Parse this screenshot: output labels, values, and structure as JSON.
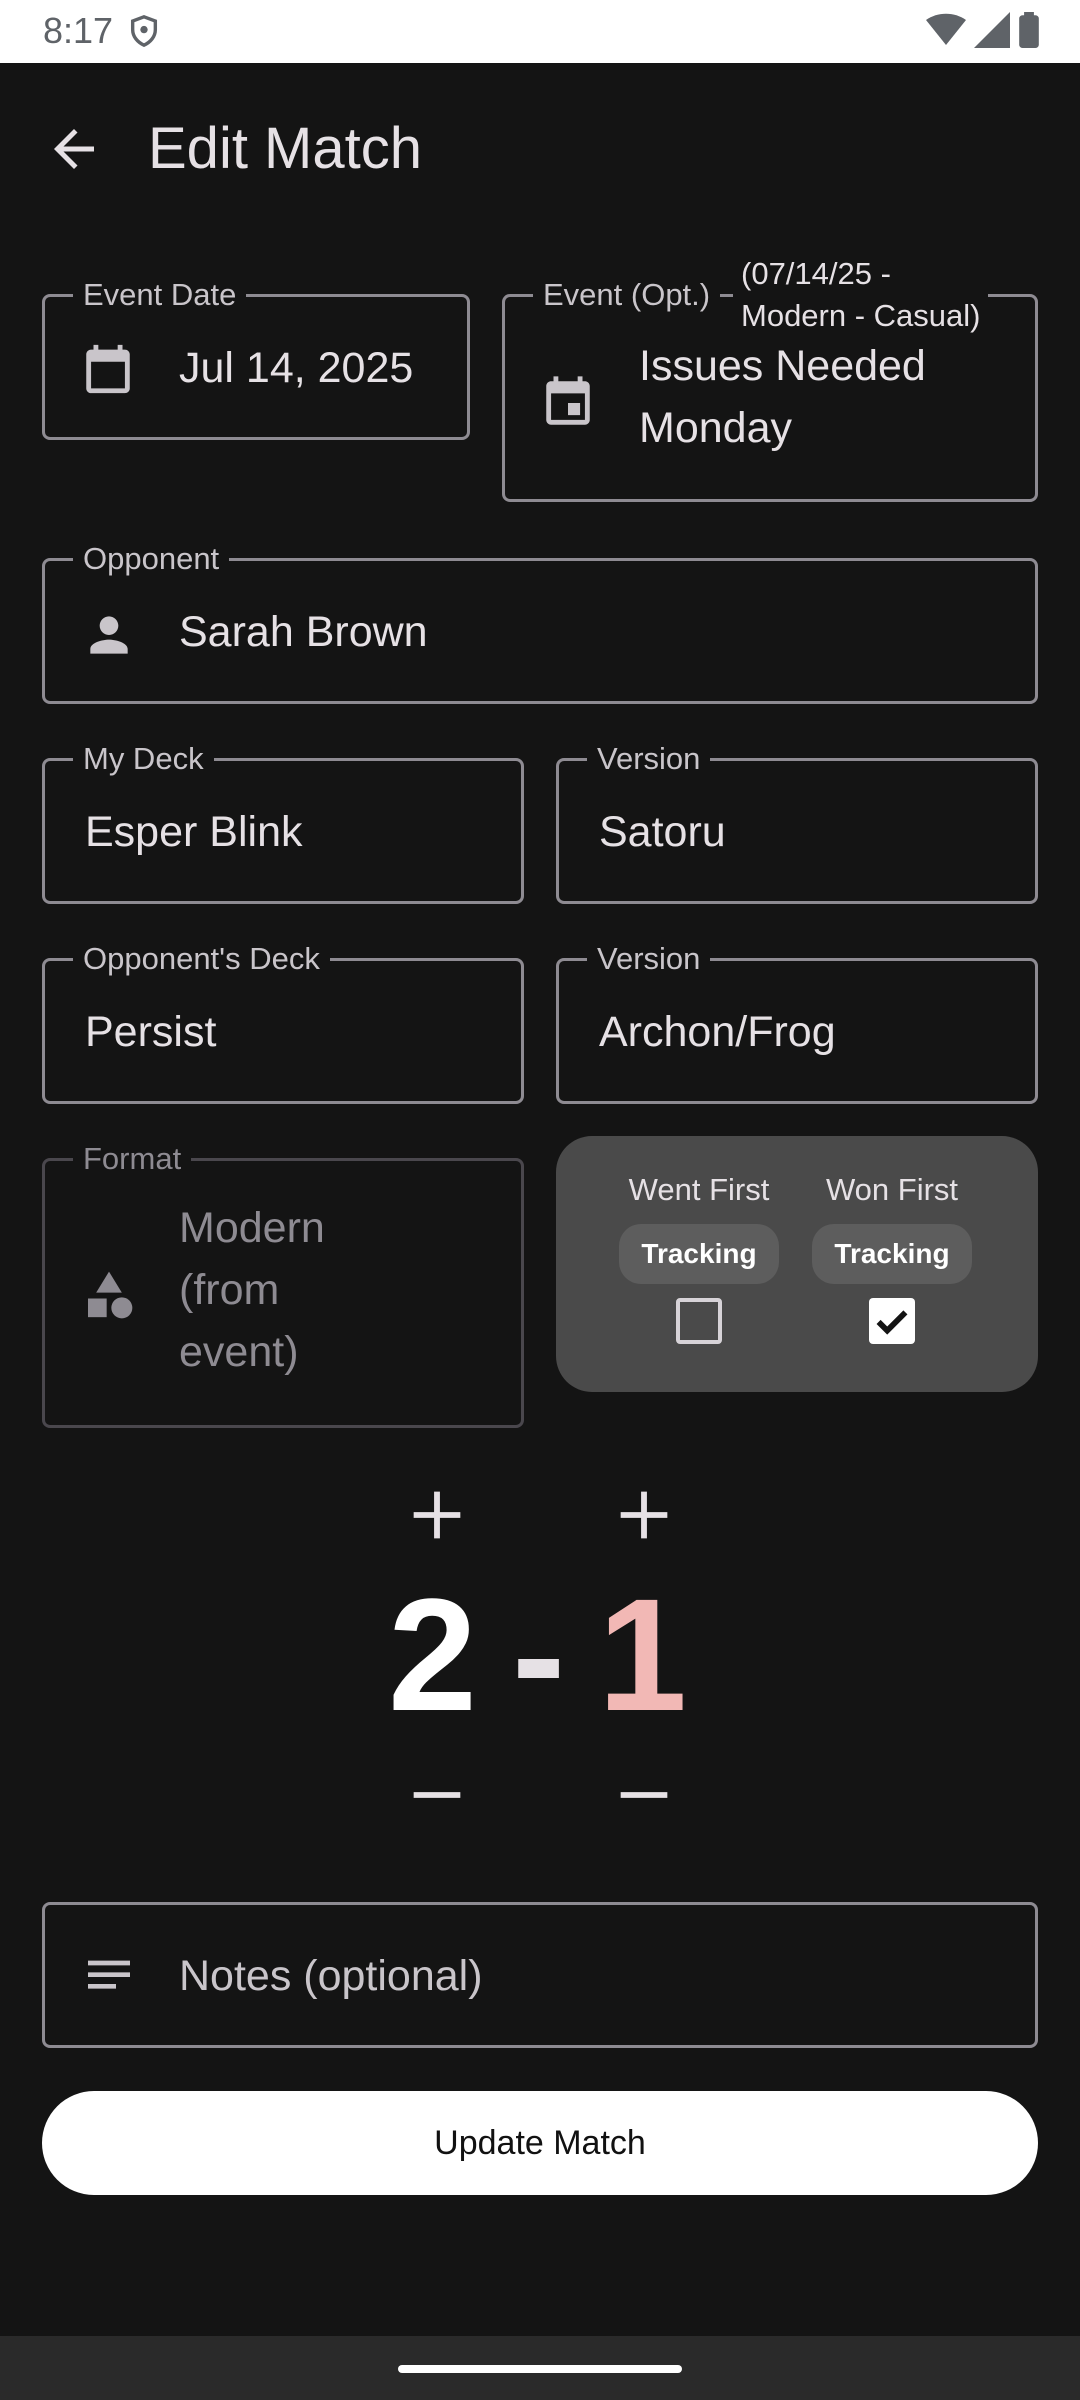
{
  "status_bar": {
    "time": "8:17"
  },
  "header": {
    "title": "Edit Match"
  },
  "form": {
    "event_date": {
      "label": "Event Date",
      "value": "Jul 14, 2025"
    },
    "event": {
      "label": "Event (Opt.)",
      "sublabel_line1": "(07/14/25 -",
      "sublabel_line2": "Modern - Casual)",
      "value_line1": "Issues Needed",
      "value_line2": "Monday"
    },
    "opponent": {
      "label": "Opponent",
      "value": "Sarah Brown"
    },
    "my_deck": {
      "label": "My Deck",
      "value": "Esper Blink"
    },
    "my_deck_version": {
      "label": "Version",
      "value": "Satoru"
    },
    "opponent_deck": {
      "label": "Opponent's Deck",
      "value": "Persist"
    },
    "opponent_deck_version": {
      "label": "Version",
      "value": "Archon/Frog"
    },
    "format": {
      "label": "Format",
      "value_line1": "Modern",
      "value_line2": "(from",
      "value_line3": "event)"
    },
    "notes": {
      "placeholder": "Notes (optional)"
    }
  },
  "toggles": {
    "went_first": {
      "label": "Went First",
      "badge": "Tracking",
      "checked": false
    },
    "won_first": {
      "label": "Won First",
      "badge": "Tracking",
      "checked": true
    }
  },
  "score": {
    "mine": "2",
    "separator": "-",
    "opponent": "1",
    "my_color": "#ffffff",
    "opponent_color": "#f2b8b5"
  },
  "actions": {
    "update_label": "Update Match"
  },
  "colors": {
    "background": "#141414",
    "accent": "#f2b8b5",
    "card": "#4a4a4a"
  }
}
